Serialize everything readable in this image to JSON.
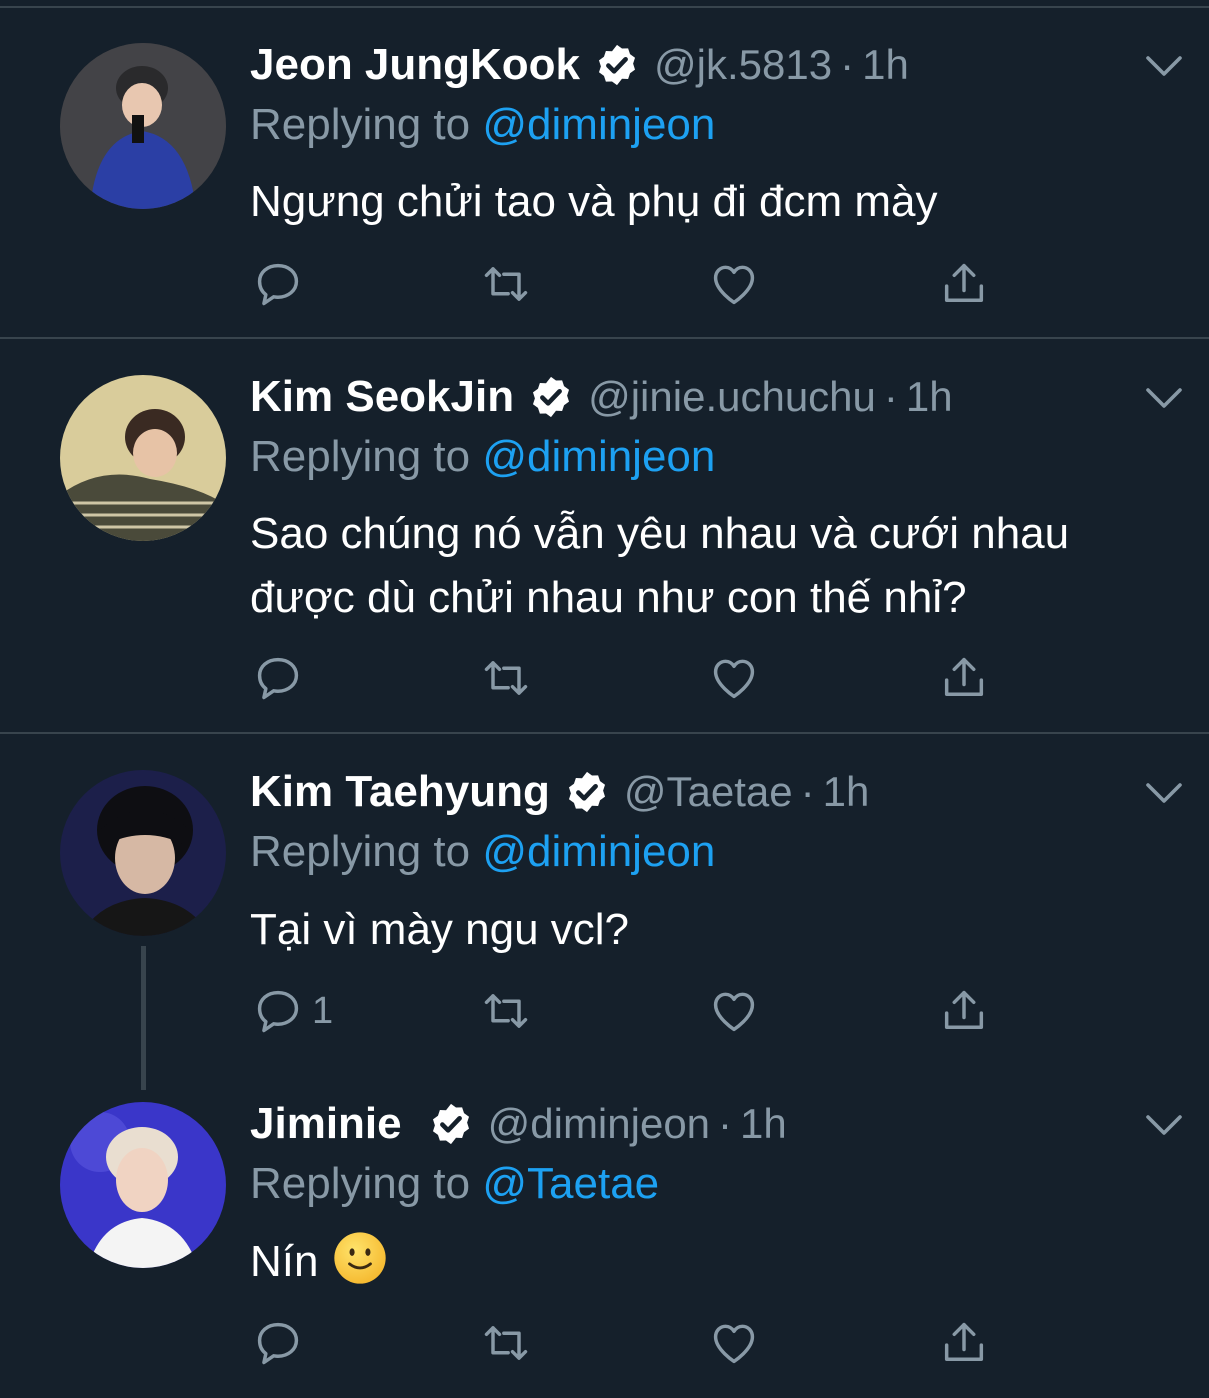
{
  "tweets": [
    {
      "name": "Jeon JungKook",
      "handle": "@jk.5813",
      "separator": "·",
      "time": "1h",
      "replying_prefix": "Replying to",
      "replying_to": "@diminjeon",
      "text": "Ngưng chửi tao và phụ đi đcm mày",
      "reply_count": "",
      "avatar_colors": {
        "bg": "#3b3a3d",
        "shirt": "#2b3fa5",
        "skin": "#e8c7b0"
      }
    },
    {
      "name": "Kim SeokJin",
      "handle": "@jinie.uchuchu",
      "separator": "·",
      "time": "1h",
      "replying_prefix": "Replying to",
      "replying_to": "@diminjeon",
      "text": "Sao chúng nó vẫn yêu nhau và cưới nhau được dù chửi nhau như con thế nhỉ?",
      "reply_count": "",
      "avatar_colors": {
        "bg": "#d9cc9b",
        "shirt": "#4a4a3a",
        "skin": "#e7c3a6"
      }
    },
    {
      "name": "Kim Taehyung",
      "handle": "@Taetae",
      "separator": "·",
      "time": "1h",
      "replying_prefix": "Replying to",
      "replying_to": "@diminjeon",
      "text": "Tại vì mày ngu vcl?",
      "reply_count": "1",
      "avatar_colors": {
        "bg": "#1c1f4a",
        "shirt": "#161616",
        "skin": "#d6b8a4"
      }
    },
    {
      "name": "Jiminie",
      "handle": "@diminjeon",
      "separator": "·",
      "time": "1h",
      "replying_prefix": "Replying to",
      "replying_to": "@Taetae",
      "text": "Nín",
      "reply_count": "",
      "avatar_colors": {
        "bg": "#3a36c9",
        "shirt": "#f4f4f4",
        "skin": "#f0d3c2"
      }
    }
  ],
  "icons": {
    "reply": "reply-icon",
    "retweet": "retweet-icon",
    "like": "like-icon",
    "share": "share-icon",
    "verified": "verified-badge-icon",
    "caret": "chevron-down-icon",
    "emoji": "slightly-smiling-face-emoji"
  },
  "colors": {
    "background": "#15202b",
    "divider": "#38444d",
    "secondary_text": "#8899a6",
    "mention": "#1da1f2"
  }
}
